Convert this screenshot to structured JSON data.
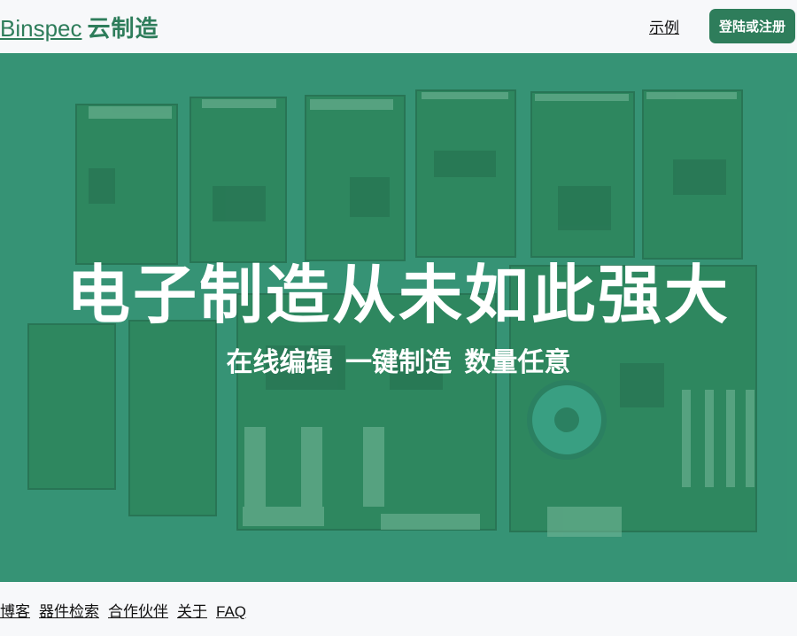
{
  "header": {
    "brand_name": "Binspec",
    "brand_suffix": "云制造",
    "nav_example": "示例",
    "signup_label": "登陆或注册"
  },
  "hero": {
    "title": "电子制造从未如此强大",
    "subtitle": "在线编辑 一键制造 数量任意"
  },
  "footer": {
    "links": [
      "博客",
      "器件检索",
      "合作伙伴",
      "关于",
      "FAQ"
    ]
  },
  "colors": {
    "brand_green": "#2e7d5b",
    "hero_overlay": "#3aa07f"
  }
}
